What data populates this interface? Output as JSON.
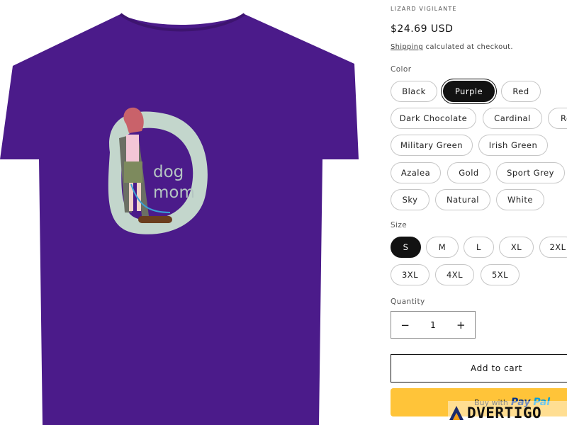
{
  "product": {
    "vendor": "LIZARD VIGILANTE",
    "price": "$24.69 USD",
    "shipping_link": "Shipping",
    "shipping_text": "calculated at checkout.",
    "shirt_text_line1": "dog",
    "shirt_text_line2": "mom",
    "shirt_color": "#4b1b8a"
  },
  "color": {
    "label": "Color",
    "selected": "Purple",
    "options": [
      "Black",
      "Purple",
      "Red",
      "Dark Chocolate",
      "Cardinal",
      "Re",
      "Military Green",
      "Irish Green",
      "Azalea",
      "Gold",
      "Sport Grey",
      "Sky",
      "Natural",
      "White"
    ]
  },
  "size": {
    "label": "Size",
    "selected": "S",
    "options": [
      "S",
      "M",
      "L",
      "XL",
      "2XL",
      "3XL",
      "4XL",
      "5XL"
    ]
  },
  "quantity": {
    "label": "Quantity",
    "value": "1",
    "minus": "−",
    "plus": "+"
  },
  "actions": {
    "add_to_cart": "Add to cart",
    "buy_with": "Buy with",
    "paypal_1": "Pay",
    "paypal_2": "Pal"
  },
  "watermark": {
    "text": "DVERTIGO"
  }
}
